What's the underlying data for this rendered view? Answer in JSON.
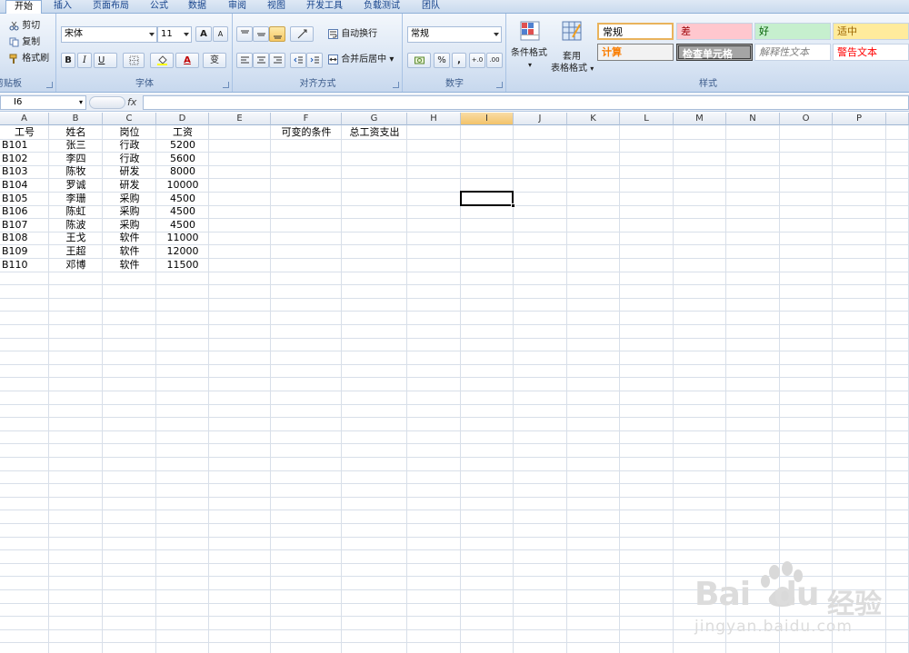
{
  "tabs": [
    "开始",
    "插入",
    "页面布局",
    "公式",
    "数据",
    "审阅",
    "视图",
    "开发工具",
    "负载测试",
    "团队"
  ],
  "clipboard": {
    "cut": "剪切",
    "copy": "复制",
    "painter": "格式刷",
    "label": "剪贴板"
  },
  "font": {
    "name": "宋体",
    "size": "11",
    "grow": "A",
    "shrink": "A",
    "bold": "B",
    "italic": "I",
    "underline": "U",
    "phonetic": "变",
    "label": "字体"
  },
  "alignment": {
    "wrap": "自动换行",
    "merge": "合并后居中",
    "label": "对齐方式"
  },
  "number": {
    "format": "常规",
    "percent": "%",
    "comma": ",",
    "label": "数字"
  },
  "styles_group": {
    "conditional": "条件格式",
    "table_line1": "套用",
    "table_line2": "表格格式",
    "label": "样式",
    "cells": [
      {
        "text": "常规",
        "color": "#000000",
        "bg": "#ffffff"
      },
      {
        "text": "差",
        "color": "#9c0006",
        "bg": "#ffc7ce"
      },
      {
        "text": "好",
        "color": "#006100",
        "bg": "#c6efce"
      },
      {
        "text": "适中",
        "color": "#9c6500",
        "bg": "#ffeb9c"
      },
      {
        "text": "计算",
        "color": "#fa7d00",
        "bg": "#f2f2f2"
      },
      {
        "text": "检查单元格",
        "color": "#ffffff",
        "bg": "#a5a5a5"
      },
      {
        "text": "解释性文本",
        "color": "#7f7f7f",
        "bg": "#ffffff"
      },
      {
        "text": "警告文本",
        "color": "#ff0000",
        "bg": "#ffffff"
      }
    ]
  },
  "formula_bar": {
    "cell_ref": "I6",
    "fx": "fx",
    "value": ""
  },
  "columns": [
    "A",
    "B",
    "C",
    "D",
    "E",
    "F",
    "G",
    "H",
    "I",
    "J",
    "K",
    "L",
    "M",
    "N",
    "O",
    "P"
  ],
  "selected_column": "I",
  "selected_cell": "I6",
  "headers": {
    "id": "工号",
    "name": "姓名",
    "position": "岗位",
    "salary": "工资",
    "f1": "可变的条件",
    "g1": "总工资支出"
  },
  "rows": [
    {
      "id": "B101",
      "name": "张三",
      "position": "行政",
      "salary": "5200"
    },
    {
      "id": "B102",
      "name": "李四",
      "position": "行政",
      "salary": "5600"
    },
    {
      "id": "B103",
      "name": "陈牧",
      "position": "研发",
      "salary": "8000"
    },
    {
      "id": "B104",
      "name": "罗诚",
      "position": "研发",
      "salary": "10000"
    },
    {
      "id": "B105",
      "name": "李珊",
      "position": "采购",
      "salary": "4500"
    },
    {
      "id": "B106",
      "name": "陈虹",
      "position": "采购",
      "salary": "4500"
    },
    {
      "id": "B107",
      "name": "陈波",
      "position": "采购",
      "salary": "4500"
    },
    {
      "id": "B108",
      "name": "王戈",
      "position": "软件",
      "salary": "11000"
    },
    {
      "id": "B109",
      "name": "王超",
      "position": "软件",
      "salary": "12000"
    },
    {
      "id": "B110",
      "name": "邓博",
      "position": "软件",
      "salary": "11500"
    }
  ],
  "watermark": {
    "brand": "Bai",
    "brand2": "du",
    "cn": "经验",
    "url": "jingyan.baidu.com"
  }
}
